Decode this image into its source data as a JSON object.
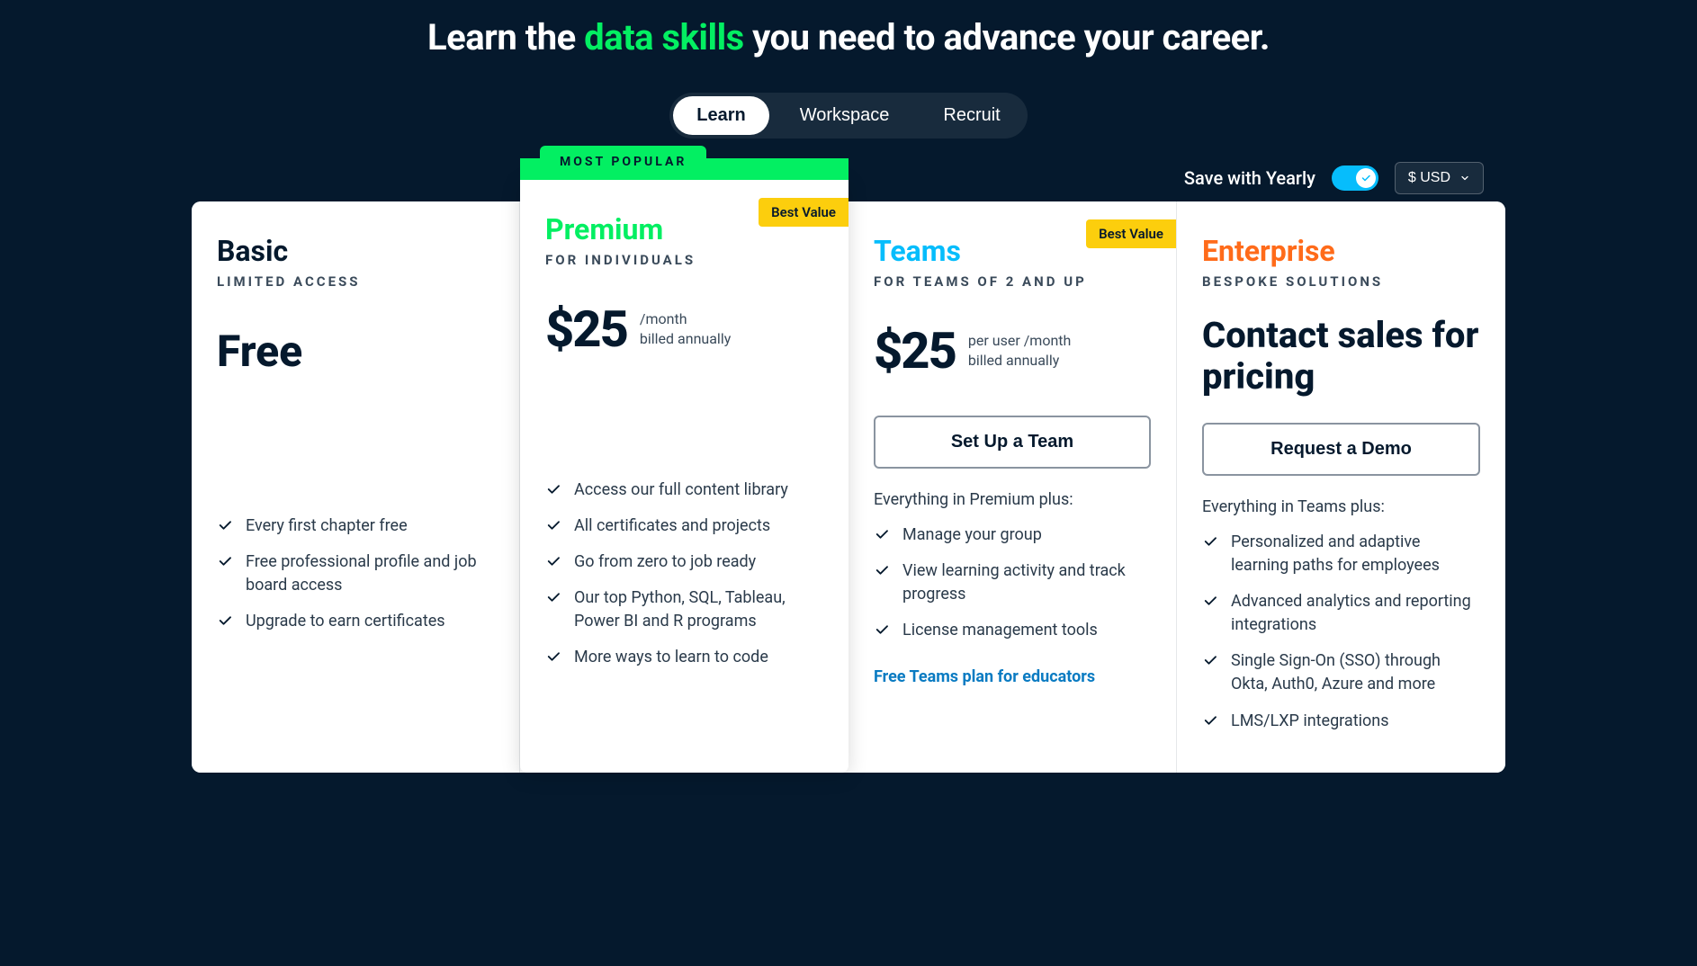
{
  "headline": {
    "pre": "Learn the ",
    "accent": "data skills",
    "post": " you need to advance your career."
  },
  "tabs": {
    "learn": "Learn",
    "workspace": "Workspace",
    "recruit": "Recruit"
  },
  "controls": {
    "yearly_label": "Save with Yearly",
    "currency": "$ USD"
  },
  "plans": {
    "basic": {
      "name": "Basic",
      "sub": "LIMITED ACCESS",
      "price": "Free",
      "features": [
        "Every first chapter free",
        "Free professional profile and job board access",
        "Upgrade to earn certificates"
      ]
    },
    "premium": {
      "pop": "MOST POPULAR",
      "badge": "Best Value",
      "name": "Premium",
      "sub": "FOR INDIVIDUALS",
      "price": "$25",
      "meta1": "/month",
      "meta2": "billed annually",
      "features": [
        "Access our full content library",
        "All certificates and projects",
        "Go from zero to job ready",
        "Our top Python, SQL, Tableau, Power BI and R programs",
        "More ways to learn to code"
      ]
    },
    "teams": {
      "badge": "Best Value",
      "name": "Teams",
      "sub": "FOR TEAMS OF 2 AND UP",
      "price": "$25",
      "meta1": "per user /month",
      "meta2": "billed annually",
      "cta": "Set Up a Team",
      "lead": "Everything in Premium plus:",
      "features": [
        "Manage your group",
        "View learning activity and track progress",
        "License management tools"
      ],
      "edu_link": "Free Teams plan for educators"
    },
    "enterprise": {
      "name": "Enterprise",
      "sub": "BESPOKE SOLUTIONS",
      "price_text": "Contact sales for pricing",
      "cta": "Request a Demo",
      "lead": "Everything in Teams plus:",
      "features": [
        "Personalized and adaptive learning paths for employees",
        "Advanced analytics and reporting integrations",
        "Single Sign-On (SSO) through Okta, Auth0, Azure and more",
        "LMS/LXP integrations"
      ]
    }
  }
}
